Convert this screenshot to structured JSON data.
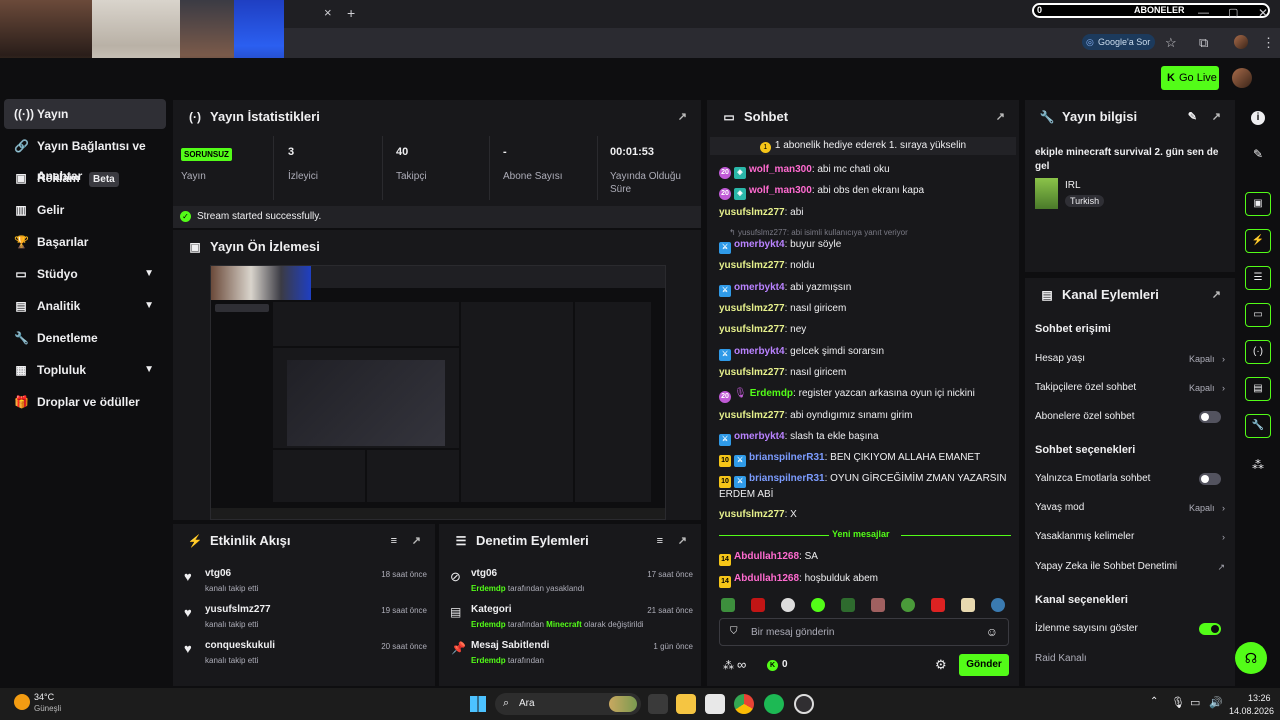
{
  "webcams": [
    "cam-1",
    "cam-2",
    "cam-3",
    "cam-4"
  ],
  "browser": {
    "tab_close": "×",
    "tab_new": "+",
    "ask_google": "Google'a Sor",
    "subscriber_count": "0",
    "subscriber_label": "ABONELER"
  },
  "header": {
    "go_live": "Go Live"
  },
  "sidebar": {
    "items": [
      {
        "label": "Yayın",
        "active": true
      },
      {
        "label": "Yayın Bağlantısı ve Anahtar"
      },
      {
        "label": "Reklam",
        "badge": "Beta"
      },
      {
        "label": "Gelir"
      },
      {
        "label": "Başarılar"
      },
      {
        "label": "Stüdyo",
        "chevron": true
      },
      {
        "label": "Analitik",
        "chevron": true
      },
      {
        "label": "Denetleme"
      },
      {
        "label": "Topluluk",
        "chevron": true
      },
      {
        "label": "Droplar ve ödüller"
      }
    ]
  },
  "stats": {
    "title": "Yayın İstatistikleri",
    "status_badge": "SORUNSUZ",
    "status_label": "Yayın",
    "viewers_value": "3",
    "viewers_label": "İzleyici",
    "followers_value": "40",
    "followers_label": "Takipçi",
    "subs_value": "-",
    "subs_label": "Abone Sayısı",
    "uptime_value": "00:01:53",
    "uptime_label_1": "Yayında Olduğu",
    "uptime_label_2": "Süre",
    "success_message": "Stream started successfully."
  },
  "preview": {
    "title": "Yayın Ön İzlemesi"
  },
  "activity": {
    "title": "Etkinlik Akışı",
    "items": [
      {
        "name": "vtg06",
        "desc": "kanalı takip etti",
        "time": "18 saat önce"
      },
      {
        "name": "yusufslmz277",
        "desc": "kanalı takip etti",
        "time": "19 saat önce"
      },
      {
        "name": "conqueskukuli",
        "desc": "kanalı takip etti",
        "time": "20 saat önce"
      }
    ]
  },
  "moderation": {
    "title": "Denetim Eylemleri",
    "items": [
      {
        "name": "vtg06",
        "actor": "Erdemdp",
        "desc": "tarafından yasaklandı",
        "time": "17 saat önce"
      },
      {
        "name": "Kategori",
        "actor": "Erdemdp",
        "desc": "tarafından",
        "highlight": "Minecraft",
        "desc2": "olarak değiştirildi",
        "time": "21 saat önce"
      },
      {
        "name": "Mesaj Sabitlendi",
        "actor": "Erdemdp",
        "desc": "tarafından",
        "time": "1 gün önce"
      }
    ]
  },
  "chat": {
    "title": "Sohbet",
    "gift_banner": "1 abonelik hediye ederek 1. sıraya yükselin",
    "reply_hint": "yusufslmz277: abi isimli kullanıcıya yanıt veriyor",
    "new_messages": "Yeni mesajlar",
    "input_placeholder": "Bir mesaj gönderin",
    "send": "Gönder",
    "infinity": "∞",
    "points": "0",
    "messages": [
      {
        "user": "wolf_man300",
        "color": "#ff6bd0",
        "text": "abi mc chati oku",
        "badge": "sub20"
      },
      {
        "user": "wolf_man300",
        "color": "#ff6bd0",
        "text": "abi obs den ekranı kapa",
        "badge": "sub20"
      },
      {
        "user": "yusufslmz277",
        "color": "#e6f08c",
        "text": "abi"
      },
      {
        "user": "omerbykt4",
        "color": "#b982ff",
        "text": "buyur söyle",
        "badge": "mod"
      },
      {
        "user": "yusufslmz277",
        "color": "#e6f08c",
        "text": "noldu"
      },
      {
        "user": "omerbykt4",
        "color": "#b982ff",
        "text": "abi yazmışsın",
        "badge": "mod"
      },
      {
        "user": "yusufslmz277",
        "color": "#e6f08c",
        "text": "nasıl giricem"
      },
      {
        "user": "yusufslmz277",
        "color": "#e6f08c",
        "text": "ney"
      },
      {
        "user": "omerbykt4",
        "color": "#b982ff",
        "text": "gelcek şimdi sorarsın",
        "badge": "mod"
      },
      {
        "user": "yusufslmz277",
        "color": "#e6f08c",
        "text": "nasıl giricem"
      },
      {
        "user": "Erdemdp",
        "color": "#53fc18",
        "text": "register yazcan arkasına oyun içi nickini",
        "badge": "sub20"
      },
      {
        "user": "yusufslmz277",
        "color": "#e6f08c",
        "text": "abi oyndıgımız sınamı girim"
      },
      {
        "user": "omerbykt4",
        "color": "#b982ff",
        "text": "slash ta ekle başına",
        "badge": "mod"
      },
      {
        "user": "brianspilnerR31",
        "color": "#7c9cff",
        "text": "BEN ÇIKIYOM ALLAHA EMANET",
        "badge": "sub"
      },
      {
        "user": "brianspilnerR31",
        "color": "#7c9cff",
        "text": "OYUN GİRCEĞİMİM ZMAN YAZARSIN ERDEM ABİ",
        "badge": "sub"
      },
      {
        "user": "yusufslmz277",
        "color": "#e6f08c",
        "text": "X"
      },
      {
        "user": "Abdullah1268",
        "color": "#ff6bd0",
        "text": "SA",
        "badge": "sub"
      },
      {
        "user": "Abdullah1268",
        "color": "#ff6bd0",
        "text": "hoşbulduk abem",
        "badge": "sub"
      }
    ],
    "badge_numbers": {
      "sub20": "20",
      "sub": "10",
      "sub14": "14"
    }
  },
  "stream_info": {
    "title": "Yayın bilgisi",
    "stream_title": "ekiple minecraft survival 2. gün sen de gel",
    "category": "IRL",
    "language": "Turkish"
  },
  "channel_actions": {
    "title": "Kanal Eylemleri",
    "chat_access": "Sohbet erişimi",
    "account_age": "Hesap yaşı",
    "account_age_value": "Kapalı",
    "followers_only": "Takipçilere özel sohbet",
    "followers_only_value": "Kapalı",
    "subs_only": "Abonelere özel sohbet",
    "chat_options": "Sohbet seçenekleri",
    "emotes_only": "Yalnızca Emotlarla sohbet",
    "slow_mode": "Yavaş mod",
    "slow_mode_value": "Kapalı",
    "banned_words": "Yasaklanmış kelimeler",
    "ai_moderation": "Yapay Zeka ile Sohbet Denetimi",
    "channel_options": "Kanal seçenekleri",
    "show_viewers": "İzlenme sayısını göster",
    "raid": "Raid Kanalı"
  },
  "taskbar": {
    "weather_temp": "34°C",
    "weather_desc": "Güneşli",
    "search": "Ara",
    "time": "13:26",
    "date": "14.08.2026"
  },
  "colors": {
    "accent": "#53fc18",
    "panel": "#18181b",
    "bg": "#0e0e10"
  }
}
